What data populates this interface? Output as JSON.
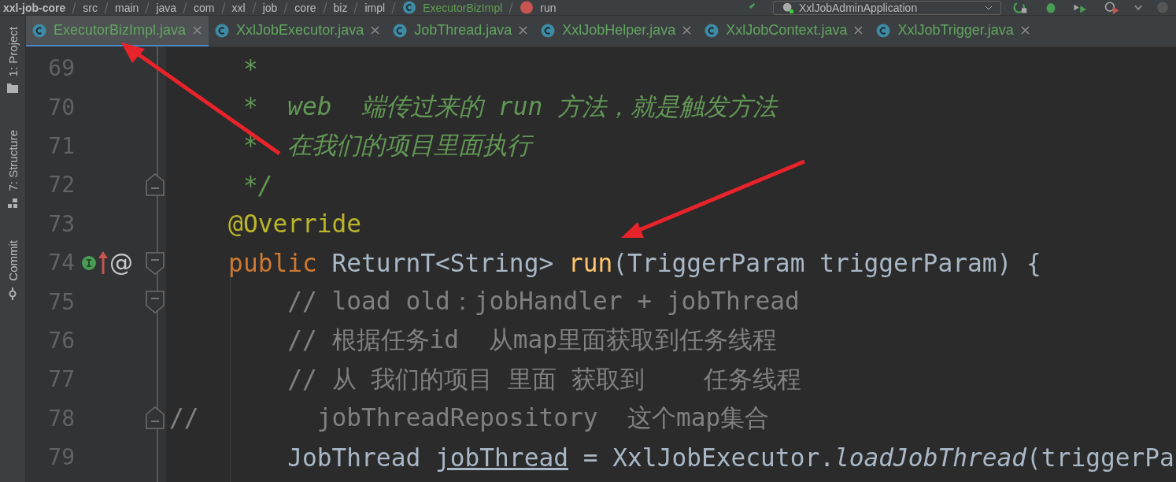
{
  "breadcrumbs": [
    {
      "text": "xxl-job-core",
      "kind": "module"
    },
    {
      "text": "src",
      "kind": "folder"
    },
    {
      "text": "main",
      "kind": "folder"
    },
    {
      "text": "java",
      "kind": "folder"
    },
    {
      "text": "com",
      "kind": "folder"
    },
    {
      "text": "xxl",
      "kind": "folder"
    },
    {
      "text": "job",
      "kind": "folder"
    },
    {
      "text": "core",
      "kind": "folder"
    },
    {
      "text": "biz",
      "kind": "folder"
    },
    {
      "text": "impl",
      "kind": "folder"
    },
    {
      "text": "ExecutorBizImpl",
      "kind": "class"
    },
    {
      "text": "run",
      "kind": "method"
    }
  ],
  "run_config": {
    "label": "XxlJobAdminApplication"
  },
  "tool_strip": [
    {
      "label": "1: Project",
      "kind": "project"
    },
    {
      "label": "7: Structure",
      "kind": "structure"
    },
    {
      "label": "Commit",
      "kind": "commit"
    }
  ],
  "tabs": [
    {
      "label": "ExecutorBizImpl.java",
      "selected": true
    },
    {
      "label": "XxlJobExecutor.java",
      "selected": false
    },
    {
      "label": "JobThread.java",
      "selected": false
    },
    {
      "label": "XxlJobHelper.java",
      "selected": false
    },
    {
      "label": "XxlJobContext.java",
      "selected": false
    },
    {
      "label": "XxlJobTrigger.java",
      "selected": false
    }
  ],
  "lines": [
    {
      "number": "69",
      "tokens": [
        {
          "kind": "doc",
          "text": "     *"
        }
      ]
    },
    {
      "number": "70",
      "tokens": [
        {
          "kind": "doc",
          "text": "     *  web  端传过来的 run 方法，就是触发方法"
        }
      ]
    },
    {
      "number": "71",
      "tokens": [
        {
          "kind": "doc",
          "text": "     *  在我们的项目里面执行"
        }
      ]
    },
    {
      "number": "72",
      "fold": {
        "kind": "end"
      },
      "tokens": [
        {
          "kind": "doc",
          "text": "     */"
        }
      ]
    },
    {
      "number": "73",
      "tokens": [
        {
          "kind": "annotation",
          "text": "    @Override"
        }
      ]
    },
    {
      "number": "74",
      "fold": {
        "kind": "start"
      },
      "gutter": [
        {
          "kind": "implemented"
        },
        {
          "kind": "overrides"
        },
        {
          "kind": "annotation",
          "text": "@"
        }
      ],
      "tokens": [
        {
          "kind": "keyword",
          "text": "    public"
        },
        {
          "kind": "plain",
          "text": " ReturnT<String> "
        },
        {
          "kind": "method",
          "text": "run"
        },
        {
          "kind": "plain",
          "text": "(TriggerParam triggerParam) {"
        }
      ]
    },
    {
      "number": "75",
      "fold": {
        "kind": "start"
      },
      "tokens": [
        {
          "kind": "comment",
          "text": "        // load old：jobHandler + jobThread"
        }
      ]
    },
    {
      "number": "76",
      "tokens": [
        {
          "kind": "comment",
          "text": "        // 根据任务id  从map里面获取到任务线程"
        }
      ]
    },
    {
      "number": "77",
      "tokens": [
        {
          "kind": "comment",
          "text": "        // 从 我们的项目 里面 获取到    任务线程"
        }
      ]
    },
    {
      "number": "78",
      "fold": {
        "kind": "end"
      },
      "tokens": [
        {
          "kind": "comment",
          "text": "//        jobThreadRepository  这个map集合"
        }
      ]
    },
    {
      "number": "79",
      "tokens": [
        {
          "kind": "plain",
          "text": "        JobThread "
        },
        {
          "kind": "reassigned",
          "text": "jobThread"
        },
        {
          "kind": "plain",
          "text": " = XxlJobExecutor."
        },
        {
          "kind": "static",
          "text": "loadJobThread"
        },
        {
          "kind": "plain",
          "text": "(triggerPa"
        }
      ]
    }
  ]
}
